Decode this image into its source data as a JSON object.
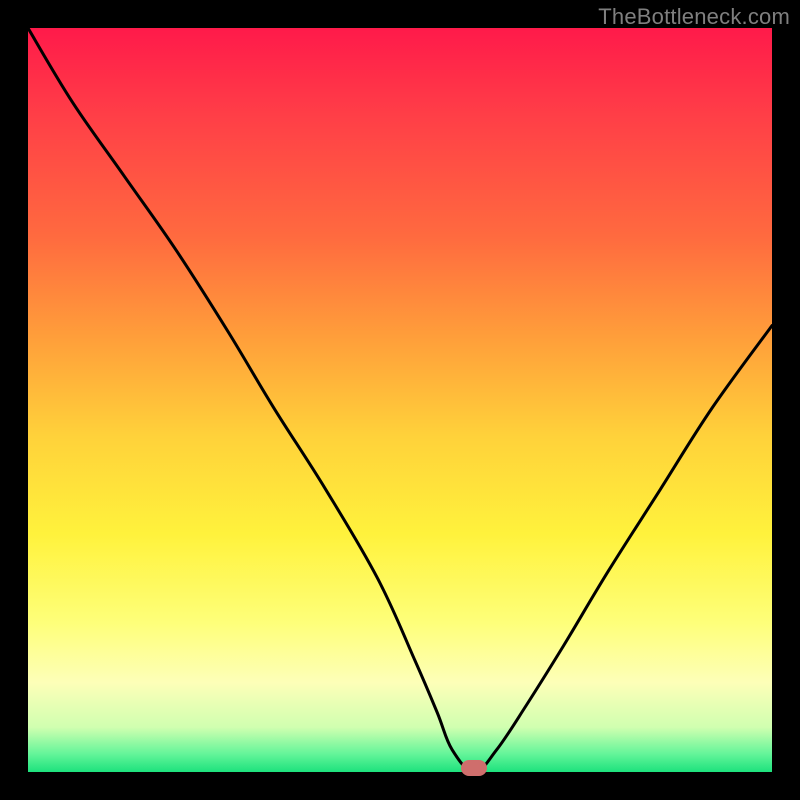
{
  "watermark": {
    "text": "TheBottleneck.com"
  },
  "gradient": {
    "stops": [
      {
        "offset": 0.0,
        "color": "#ff1a4a"
      },
      {
        "offset": 0.12,
        "color": "#ff3f47"
      },
      {
        "offset": 0.28,
        "color": "#ff6a3f"
      },
      {
        "offset": 0.42,
        "color": "#ffa03a"
      },
      {
        "offset": 0.55,
        "color": "#ffd23a"
      },
      {
        "offset": 0.68,
        "color": "#fff23c"
      },
      {
        "offset": 0.8,
        "color": "#feff7a"
      },
      {
        "offset": 0.88,
        "color": "#fdffb8"
      },
      {
        "offset": 0.94,
        "color": "#d0ffb0"
      },
      {
        "offset": 0.975,
        "color": "#66f59a"
      },
      {
        "offset": 1.0,
        "color": "#1de27d"
      }
    ]
  },
  "marker": {
    "color": "#cf6e6c",
    "x_pct": 60,
    "y_pct": 99.2
  },
  "chart_data": {
    "type": "line",
    "title": "",
    "xlabel": "",
    "ylabel": "",
    "xlim": [
      0,
      100
    ],
    "ylim": [
      0,
      100
    ],
    "series": [
      {
        "name": "bottleneck-curve",
        "x": [
          0,
          6,
          13,
          20,
          27,
          33,
          40,
          47,
          52,
          55,
          57,
          60,
          63,
          67,
          72,
          78,
          85,
          92,
          100
        ],
        "y": [
          100,
          90,
          80,
          70,
          59,
          49,
          38,
          26,
          15,
          8,
          3,
          0,
          3,
          9,
          17,
          27,
          38,
          49,
          60
        ]
      }
    ],
    "marker_point": {
      "x": 60,
      "y": 0
    }
  }
}
